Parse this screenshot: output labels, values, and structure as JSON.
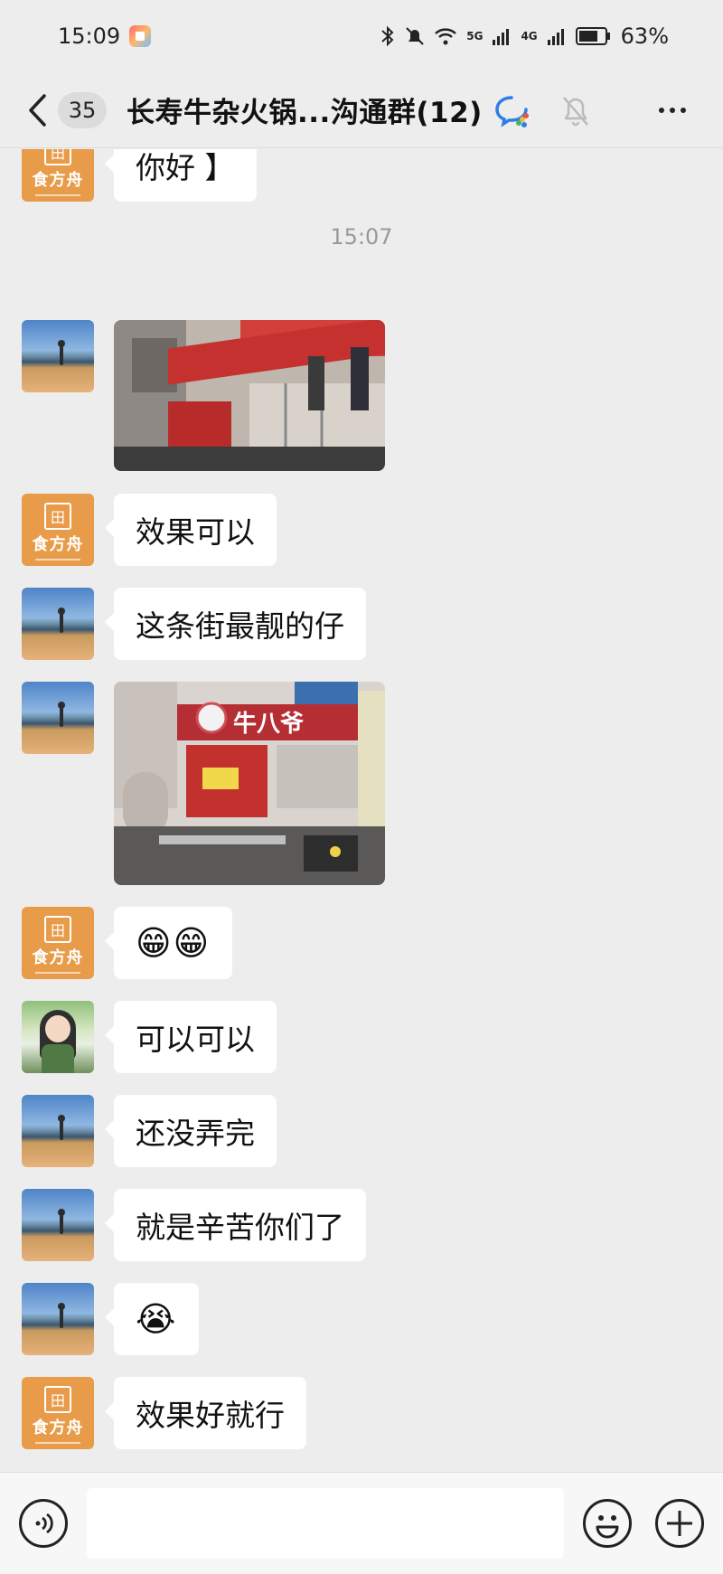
{
  "status_bar": {
    "time": "15:09",
    "network_1": "5G",
    "network_2": "4G",
    "battery": "63%"
  },
  "header": {
    "unread_count": "35",
    "title": "长寿牛杂火锅...沟通群(12)",
    "icons": [
      "back-icon",
      "wecom-icon",
      "mute-bell-icon",
      "more-icon"
    ]
  },
  "brand_avatar_label": "食方舟",
  "chat": {
    "top_partial_text": "你好 】",
    "timestamp": "15:07",
    "messages": [
      {
        "sender_avatar": "photo",
        "type": "image",
        "caption": ""
      },
      {
        "sender_avatar": "brand",
        "type": "text",
        "text": "效果可以"
      },
      {
        "sender_avatar": "photo",
        "type": "text",
        "text": "这条街最靓的仔"
      },
      {
        "sender_avatar": "photo",
        "type": "image",
        "caption": "牛八爷"
      },
      {
        "sender_avatar": "brand",
        "type": "emoji",
        "text": "😁😁"
      },
      {
        "sender_avatar": "girl",
        "type": "text",
        "text": "可以可以"
      },
      {
        "sender_avatar": "photo",
        "type": "text",
        "text": "还没弄完"
      },
      {
        "sender_avatar": "photo",
        "type": "text",
        "text": "就是辛苦你们了"
      },
      {
        "sender_avatar": "photo",
        "type": "emoji",
        "text": "😭"
      },
      {
        "sender_avatar": "brand",
        "type": "text",
        "text": "效果好就行"
      }
    ]
  },
  "input_bar": {
    "value": "",
    "icons": [
      "voice-icon",
      "emoji-icon",
      "plus-icon"
    ]
  },
  "colors": {
    "background": "#ededed",
    "bubble": "#ffffff",
    "brand_orange": "#e89b49",
    "timestamp": "#999999"
  }
}
